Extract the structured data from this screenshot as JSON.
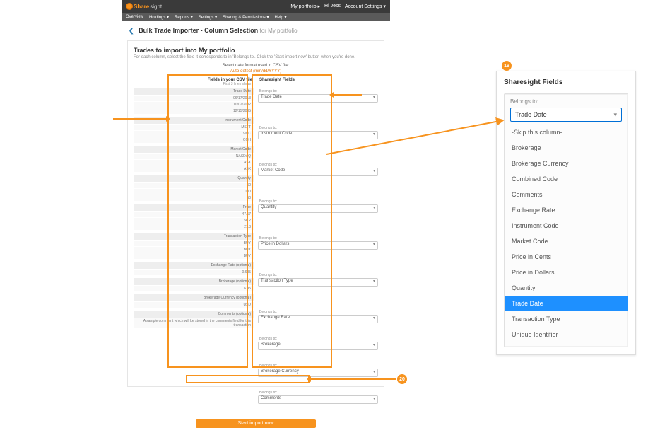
{
  "topbar": {
    "brand1": "Share",
    "brand2": "sight",
    "portfolio_link": "My portfolio ▸",
    "greeting": "Hi Jess",
    "account": "Account Settings ▾"
  },
  "menubar": {
    "items": [
      "Overview",
      "Holdings ▾",
      "Reports ▾",
      "Settings ▾",
      "Sharing & Permissions ▾",
      "Help ▾"
    ]
  },
  "breadcrumb": {
    "back": "❮",
    "title": "Bulk Trade Importer - Column Selection",
    "suffix": "for My portfolio"
  },
  "content": {
    "heading": "Trades to import into My portfolio",
    "sub": "For each column, select the field it corresponds to in 'Belongs to'. Click the 'Start import now' button when you're done.",
    "date_row": "Select date format used in CSV file:",
    "date_sel": "Auto-detect (mm/dd/YYYY)"
  },
  "left_head": {
    "title": "Fields in your CSV file",
    "sub": "First 3 lines shown"
  },
  "right_head": {
    "title": "Sharesight Fields"
  },
  "groups": [
    {
      "label": "Trade Date",
      "lines": [
        "06/17/2013",
        "10/02/2002",
        "12/15/2005"
      ],
      "belongs": "Belongs to:",
      "select": "Trade Date"
    },
    {
      "label": "Instrument Code",
      "lines": [
        "MSFT",
        "VMC",
        "COH"
      ],
      "belongs": "Belongs to:",
      "select": "Instrument Code"
    },
    {
      "label": "Market Code",
      "lines": [
        "NASDAQ",
        "ASX",
        "ASX"
      ],
      "belongs": "Belongs to:",
      "select": "Market Code"
    },
    {
      "label": "Quantity",
      "lines": [
        "50",
        "100",
        "50"
      ],
      "belongs": "Belongs to:",
      "select": "Quantity"
    },
    {
      "label": "Price",
      "lines": [
        "47.57",
        "56.2",
        "21.3"
      ],
      "belongs": "Belongs to:",
      "select": "Price in Dollars"
    },
    {
      "label": "Transaction Type",
      "lines": [
        "BUY",
        "BUY",
        "BUY"
      ],
      "belongs": "Belongs to:",
      "select": "Transaction Type"
    },
    {
      "label": "Exchange Rate (optional)",
      "lines": [
        "0.635",
        "",
        ""
      ],
      "belongs": "Belongs to:",
      "select": "Exchange Rate"
    },
    {
      "label": "Brokerage (optional)",
      "lines": [
        "6.95",
        "",
        ""
      ],
      "belongs": "Belongs to:",
      "select": "Brokerage"
    },
    {
      "label": "Brokerage Currency (optional)",
      "lines": [
        "USD",
        "",
        ""
      ],
      "belongs": "Belongs to:",
      "select": "Brokerage Currency"
    },
    {
      "label": "Comments (optional)",
      "lines": [
        "A sample comment which will be stored in the comments field for this transaction",
        "",
        ""
      ],
      "belongs": "Belongs to:",
      "select": "Comments"
    }
  ],
  "import_btn": "Start import now",
  "detail": {
    "title": "Sharesight Fields",
    "belongs": "Belongs to:",
    "selected": "Trade Date",
    "options": [
      "-Skip this column-",
      "Brokerage",
      "Brokerage Currency",
      "Combined Code",
      "Comments",
      "Exchange Rate",
      "Instrument Code",
      "Market Code",
      "Price in Cents",
      "Price in Dollars",
      "Quantity",
      "Trade Date",
      "Transaction Type",
      "Unique Identifier"
    ]
  },
  "badges": {
    "top": "19",
    "bottom": "20"
  }
}
